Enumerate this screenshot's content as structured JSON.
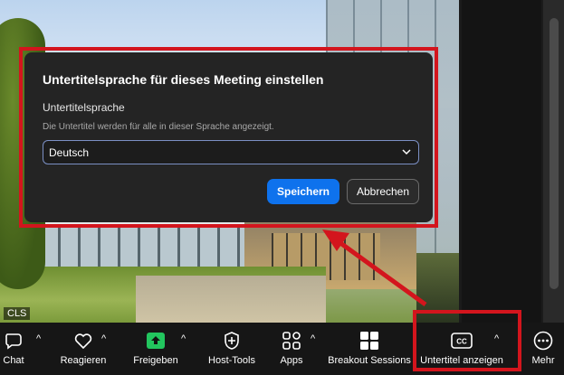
{
  "video": {
    "participant_label": "CLS"
  },
  "dialog": {
    "title": "Untertitelsprache für dieses Meeting einstellen",
    "label": "Untertitelsprache",
    "hint": "Die Untertitel werden für alle in dieser Sprache angezeigt.",
    "selected_language": "Deutsch",
    "save_label": "Speichern",
    "cancel_label": "Abbrechen"
  },
  "toolbar": {
    "items": [
      {
        "label": "Chat",
        "icon": "chat-icon"
      },
      {
        "label": "Reagieren",
        "icon": "heart-icon"
      },
      {
        "label": "Freigeben",
        "icon": "share-screen-icon"
      },
      {
        "label": "Host-Tools",
        "icon": "shield-icon"
      },
      {
        "label": "Apps",
        "icon": "apps-icon"
      },
      {
        "label": "Breakout Sessions",
        "icon": "grid-icon"
      },
      {
        "label": "Untertitel anzeigen",
        "icon": "closed-captions-icon"
      },
      {
        "label": "Mehr",
        "icon": "more-icon"
      }
    ]
  },
  "colors": {
    "highlight": "#d3151d",
    "primary": "#0e72ed",
    "share": "#22c55e"
  }
}
